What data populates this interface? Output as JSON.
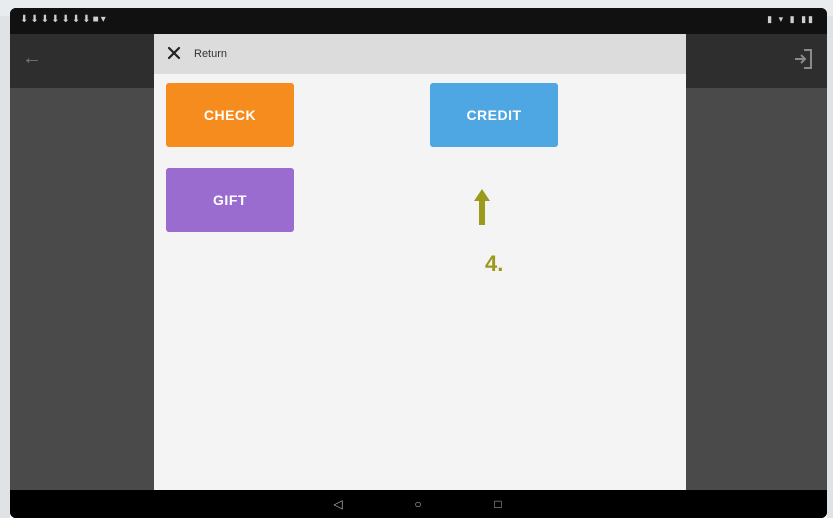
{
  "dialog": {
    "title": "Return",
    "buttons": [
      {
        "label": "CHECK",
        "color": "#f68b1e"
      },
      {
        "label": "CREDIT",
        "color": "#4ea6e3"
      },
      {
        "label": "GIFT",
        "color": "#9b6ccf"
      }
    ]
  },
  "annotation": {
    "step": "4.",
    "color": "#9c9a1c"
  },
  "icons": {
    "close": "close-icon",
    "back": "back-arrow-icon",
    "logout": "logout-icon",
    "nav_back": "nav-back-icon",
    "nav_home": "nav-home-icon",
    "nav_recents": "nav-recents-icon"
  }
}
